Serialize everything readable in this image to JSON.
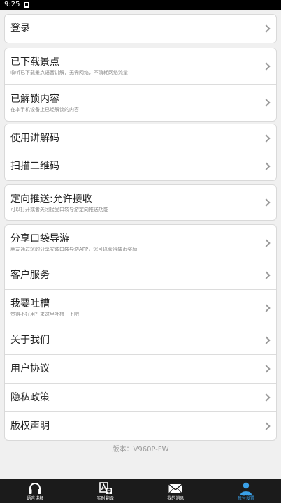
{
  "status_bar": {
    "time": "9:25"
  },
  "cards": [
    {
      "rows": [
        {
          "title": "登录",
          "sub": ""
        }
      ]
    },
    {
      "rows": [
        {
          "title": "已下载景点",
          "sub": "收听已下载景点语音讲解，无需网络，不消耗网络流量"
        },
        {
          "title": "已解锁内容",
          "sub": "在本手机设备上已经解锁的内容"
        }
      ]
    },
    {
      "rows": [
        {
          "title": "使用讲解码",
          "sub": ""
        },
        {
          "title": "扫描二维码",
          "sub": ""
        }
      ]
    },
    {
      "rows": [
        {
          "title": "定向推送:允许接收",
          "sub": "可以打开或者关闭接受口袋导游定向推送功能"
        }
      ]
    },
    {
      "rows": [
        {
          "title": "分享口袋导游",
          "sub": "朋友通过您的分享安装口袋导游APP，您可以获得袋币奖励"
        },
        {
          "title": "客户服务",
          "sub": ""
        },
        {
          "title": "我要吐槽",
          "sub": "觉得不好用？来这里吐槽一下吧"
        },
        {
          "title": "关于我们",
          "sub": ""
        },
        {
          "title": "用户协议",
          "sub": ""
        },
        {
          "title": "隐私政策",
          "sub": ""
        },
        {
          "title": "版权声明",
          "sub": ""
        }
      ]
    }
  ],
  "version_text": "版本：V960P-FW",
  "tabs": [
    {
      "label": "语音讲解",
      "icon": "headphones-icon",
      "active": false
    },
    {
      "label": "实时翻译",
      "icon": "translate-icon",
      "active": false
    },
    {
      "label": "我的消息",
      "icon": "envelope-icon",
      "active": false
    },
    {
      "label": "账号设置",
      "icon": "person-icon",
      "active": true
    }
  ],
  "colors": {
    "active_tab": "#3aa0e8",
    "tabbar_bg": "#1b1b1b",
    "page_bg": "#f0f0f0"
  }
}
